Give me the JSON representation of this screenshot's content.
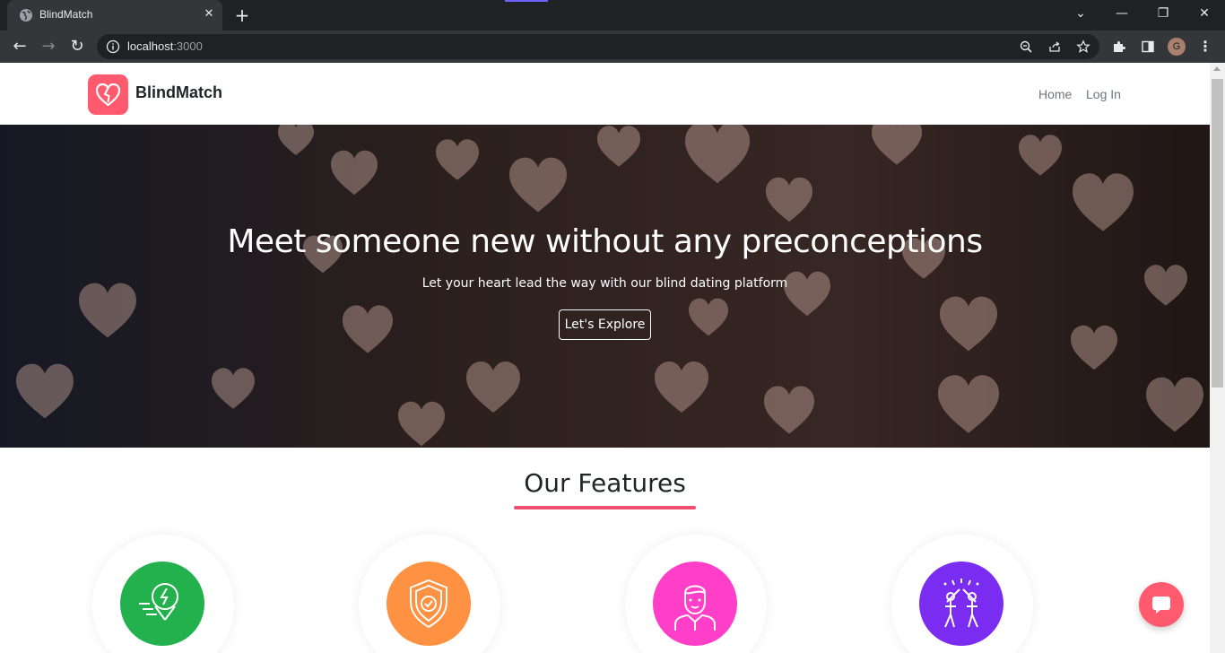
{
  "browser": {
    "tab_title": "BlindMatch",
    "url_host": "localhost",
    "url_port": ":3000",
    "profile_initial": "G"
  },
  "navbar": {
    "brand": "BlindMatch",
    "links": [
      "Home",
      "Log In"
    ]
  },
  "hero": {
    "heading": "Meet someone new without any preconceptions",
    "subheading": "Let your heart lead the way with our blind dating platform",
    "cta_label": "Let's Explore"
  },
  "features": {
    "title": "Our Features",
    "items": [
      {
        "icon": "lightning-location-icon",
        "color": "#22b14c"
      },
      {
        "icon": "shield-check-icon",
        "color": "#ff9142"
      },
      {
        "icon": "person-icon",
        "color": "#ff3fc8"
      },
      {
        "icon": "couple-celebration-icon",
        "color": "#7a2cf0"
      }
    ]
  },
  "colors": {
    "brand": "#ff5a6e",
    "underline": "#f0506e"
  }
}
